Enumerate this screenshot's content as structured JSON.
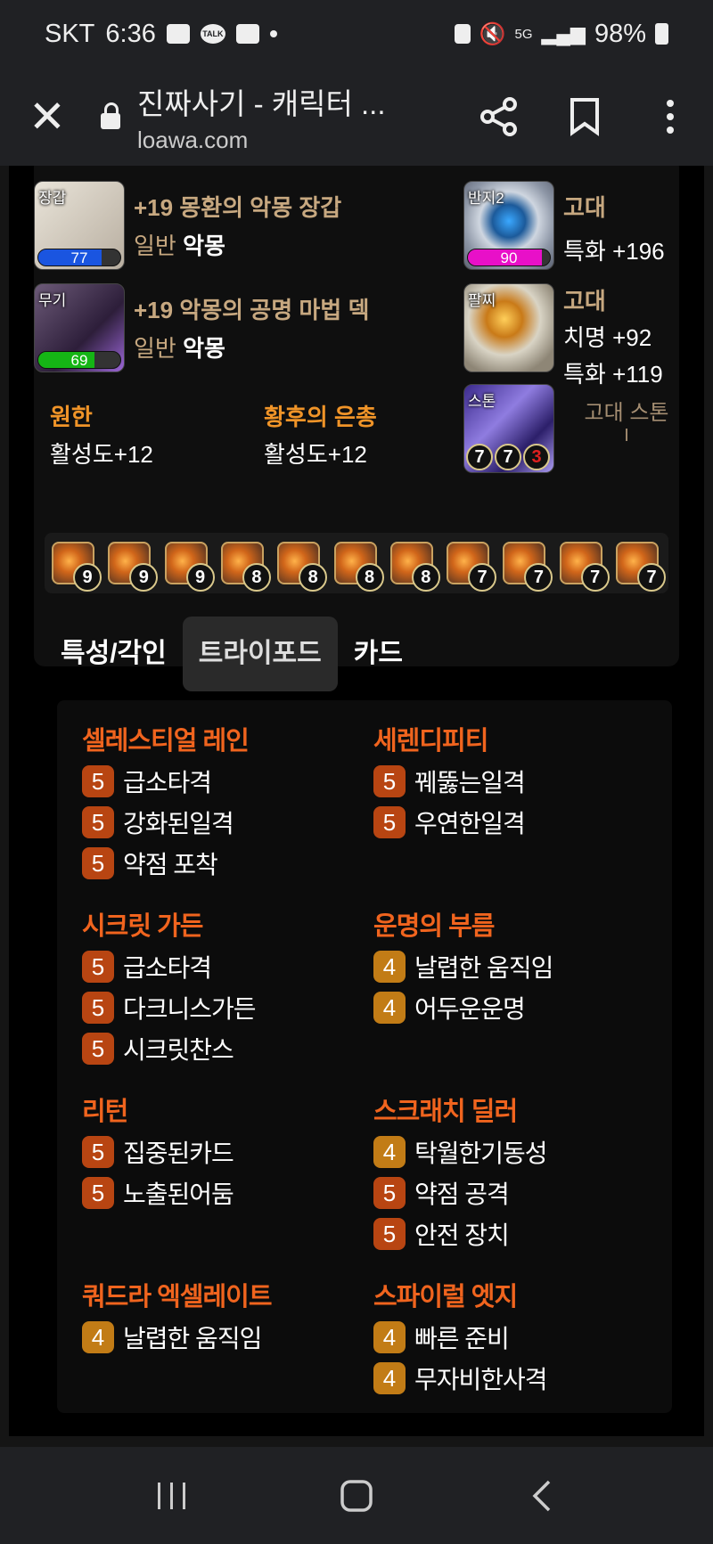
{
  "status_bar": {
    "carrier": "SKT",
    "time": "6:36",
    "battery": "98%",
    "network": "5G"
  },
  "browser": {
    "title": "진짜사기 - 캐릭터 ...",
    "url": "loawa.com"
  },
  "equipment": {
    "gloves": {
      "tag": "장갑",
      "quality": "77",
      "name": "+19 몽환의 악몽 장갑",
      "grade_prefix": "일반",
      "grade": "악몽"
    },
    "weapon": {
      "tag": "무기",
      "quality": "69",
      "name": "+19 악몽의 공명 마법 덱",
      "grade_prefix": "일반",
      "grade": "악몽"
    },
    "ring2": {
      "tag": "반지2",
      "quality": "90",
      "tier": "고대",
      "stat1": "특화 +196"
    },
    "bracelet": {
      "tag": "팔찌",
      "tier": "고대",
      "stat1": "치명 +92",
      "stat2": "특화 +119"
    },
    "stone": {
      "tag": "스톤",
      "n1": "7",
      "n2": "7",
      "n3": "3",
      "label": "고대 스톤",
      "label2": "I"
    }
  },
  "engravings": [
    {
      "name": "원한",
      "value": "활성도+12"
    },
    {
      "name": "황후의 은총",
      "value": "활성도+12"
    }
  ],
  "gems": [
    "9",
    "9",
    "9",
    "8",
    "8",
    "8",
    "8",
    "7",
    "7",
    "7",
    "7"
  ],
  "tabs": [
    "특성/각인",
    "트라이포드",
    "카드"
  ],
  "skills": [
    {
      "name": "셀레스티얼 레인",
      "tripods": [
        {
          "lv": "5",
          "name": "급소타격"
        },
        {
          "lv": "5",
          "name": "강화된일격"
        },
        {
          "lv": "5",
          "name": "약점 포착"
        }
      ]
    },
    {
      "name": "세렌디피티",
      "tripods": [
        {
          "lv": "5",
          "name": "꿰뚫는일격"
        },
        {
          "lv": "5",
          "name": "우연한일격"
        }
      ]
    },
    {
      "name": "시크릿 가든",
      "tripods": [
        {
          "lv": "5",
          "name": "급소타격"
        },
        {
          "lv": "5",
          "name": "다크니스가든"
        },
        {
          "lv": "5",
          "name": "시크릿찬스"
        }
      ]
    },
    {
      "name": "운명의 부름",
      "tripods": [
        {
          "lv": "4",
          "name": "날렵한 움직임"
        },
        {
          "lv": "4",
          "name": "어두운운명"
        }
      ]
    },
    {
      "name": "리턴",
      "tripods": [
        {
          "lv": "5",
          "name": "집중된카드"
        },
        {
          "lv": "5",
          "name": "노출된어둠"
        }
      ]
    },
    {
      "name": "스크래치 딜러",
      "tripods": [
        {
          "lv": "4",
          "name": "탁월한기동성"
        },
        {
          "lv": "5",
          "name": "약점 공격"
        },
        {
          "lv": "5",
          "name": "안전 장치"
        }
      ]
    },
    {
      "name": "쿼드라 엑셀레이트",
      "tripods": [
        {
          "lv": "4",
          "name": "날렵한 움직임"
        }
      ]
    },
    {
      "name": "스파이럴 엣지",
      "tripods": [
        {
          "lv": "4",
          "name": "빠른 준비"
        },
        {
          "lv": "4",
          "name": "무자비한사격"
        }
      ]
    }
  ]
}
